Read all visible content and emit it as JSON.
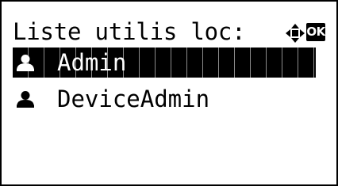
{
  "header": {
    "title": "Liste utilis loc:",
    "nav_icon": "four-way-arrow-icon",
    "ok_label": "OK"
  },
  "list": {
    "items": [
      {
        "label": "Admin",
        "icon": "user-icon",
        "selected": true
      },
      {
        "label": "DeviceAdmin",
        "icon": "user-icon",
        "selected": false
      }
    ]
  },
  "colors": {
    "foreground": "#000000",
    "background": "#ffffff"
  }
}
